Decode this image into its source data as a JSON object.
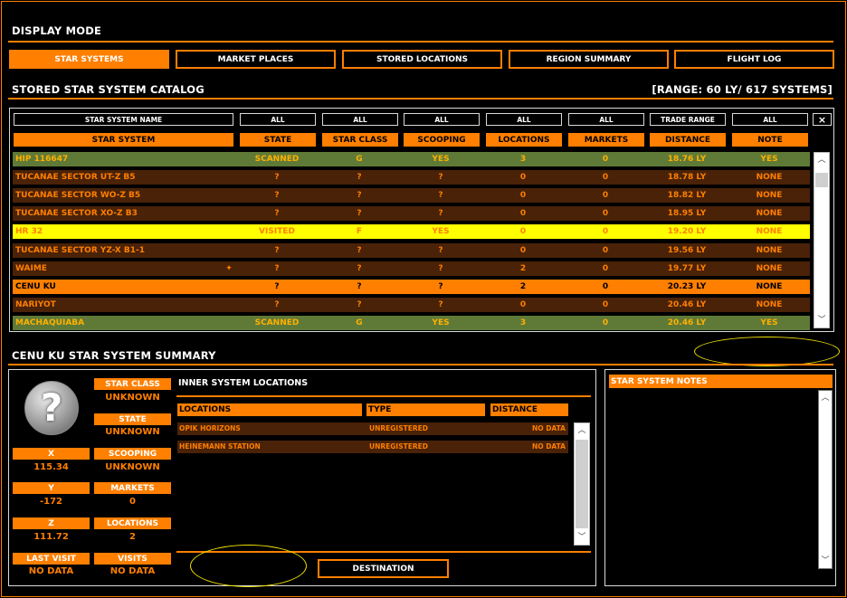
{
  "display_mode": {
    "heading": "DISPLAY MODE",
    "buttons": [
      {
        "label": "STAR SYSTEMS",
        "active": true
      },
      {
        "label": "MARKET PLACES",
        "active": false
      },
      {
        "label": "STORED LOCATIONS",
        "active": false
      },
      {
        "label": "REGION SUMMARY",
        "active": false
      },
      {
        "label": "FLIGHT LOG",
        "active": false
      }
    ]
  },
  "catalog": {
    "heading": "STORED STAR SYSTEM CATALOG",
    "range": "[RANGE: 60 LY/ 617 SYSTEMS]",
    "filters": [
      "STAR SYSTEM NAME",
      "ALL",
      "ALL",
      "ALL",
      "ALL",
      "ALL",
      "TRADE RANGE",
      "ALL"
    ],
    "clear_label": "×",
    "columns": [
      "STAR SYSTEM",
      "STATE",
      "STAR CLASS",
      "SCOOPING",
      "LOCATIONS",
      "MARKETS",
      "DISTANCE",
      "NOTE"
    ],
    "rows": [
      {
        "name": "HIP 116647",
        "fav": "",
        "state": "SCANNED",
        "class": "G",
        "scoop": "YES",
        "loc": "3",
        "mkt": "0",
        "dist": "18.76 LY",
        "note": "YES",
        "style": "scanned"
      },
      {
        "name": "TUCANAE SECTOR UT-Z B5",
        "fav": "",
        "state": "?",
        "class": "?",
        "scoop": "?",
        "loc": "0",
        "mkt": "0",
        "dist": "18.78 LY",
        "note": "NONE",
        "style": "brown"
      },
      {
        "name": "TUCANAE SECTOR WO-Z B5",
        "fav": "",
        "state": "?",
        "class": "?",
        "scoop": "?",
        "loc": "0",
        "mkt": "0",
        "dist": "18.82 LY",
        "note": "NONE",
        "style": "brown"
      },
      {
        "name": "TUCANAE SECTOR XO-Z B3",
        "fav": "",
        "state": "?",
        "class": "?",
        "scoop": "?",
        "loc": "0",
        "mkt": "0",
        "dist": "18.95 LY",
        "note": "NONE",
        "style": "brown"
      },
      {
        "name": "HR 32",
        "fav": "",
        "state": "VISITED",
        "class": "F",
        "scoop": "YES",
        "loc": "0",
        "mkt": "0",
        "dist": "19.20 LY",
        "note": "NONE",
        "style": "visited"
      },
      {
        "name": "TUCANAE SECTOR YZ-X B1-1",
        "fav": "",
        "state": "?",
        "class": "?",
        "scoop": "?",
        "loc": "0",
        "mkt": "0",
        "dist": "19.56 LY",
        "note": "NONE",
        "style": "brown"
      },
      {
        "name": "WAIME",
        "fav": "✦",
        "state": "?",
        "class": "?",
        "scoop": "?",
        "loc": "2",
        "mkt": "0",
        "dist": "19.77 LY",
        "note": "NONE",
        "style": "brown"
      },
      {
        "name": "CENU KU",
        "fav": "",
        "state": "?",
        "class": "?",
        "scoop": "?",
        "loc": "2",
        "mkt": "0",
        "dist": "20.23 LY",
        "note": "NONE",
        "style": "selected"
      },
      {
        "name": "NARIYOT",
        "fav": "",
        "state": "?",
        "class": "?",
        "scoop": "?",
        "loc": "0",
        "mkt": "0",
        "dist": "20.46 LY",
        "note": "NONE",
        "style": "brown"
      },
      {
        "name": "MACHAQUIABA",
        "fav": "",
        "state": "SCANNED",
        "class": "G",
        "scoop": "YES",
        "loc": "3",
        "mkt": "0",
        "dist": "20.46 LY",
        "note": "YES",
        "style": "scanned"
      }
    ]
  },
  "summary": {
    "heading": "CENU KU STAR SYSTEM SUMMARY",
    "star_class_label": "STAR CLASS",
    "star_class": "UNKNOWN",
    "state_label": "STATE",
    "state": "UNKNOWN",
    "x_label": "X",
    "x": "115.34",
    "scooping_label": "SCOOPING",
    "scooping": "UNKNOWN",
    "y_label": "Y",
    "y": "-172",
    "markets_label": "MARKETS",
    "markets": "0",
    "z_label": "Z",
    "z": "111.72",
    "locations_label": "LOCATIONS",
    "locations": "2",
    "last_visit_label": "LAST VISIT",
    "last_visit": "NO DATA",
    "visits_label": "VISITS",
    "visits": "NO DATA",
    "icon_glyph": "?"
  },
  "inner": {
    "heading": "INNER SYSTEM LOCATIONS",
    "columns": [
      "LOCATIONS",
      "TYPE",
      "DISTANCE"
    ],
    "rows": [
      {
        "name": "OPIK HORIZONS",
        "type": "UNREGISTERED",
        "dist": "NO DATA"
      },
      {
        "name": "HEINEMANN STATION",
        "type": "UNREGISTERED",
        "dist": "NO DATA"
      }
    ],
    "destination_label": "DESTINATION"
  },
  "notes": {
    "heading": "STAR SYSTEM NOTES"
  },
  "colors": {
    "accent": "#ff7f00",
    "row_brown": "#4a2208",
    "row_scanned": "#5f7a37",
    "row_visited": "#ffff00",
    "annotation": "#f0e000"
  }
}
